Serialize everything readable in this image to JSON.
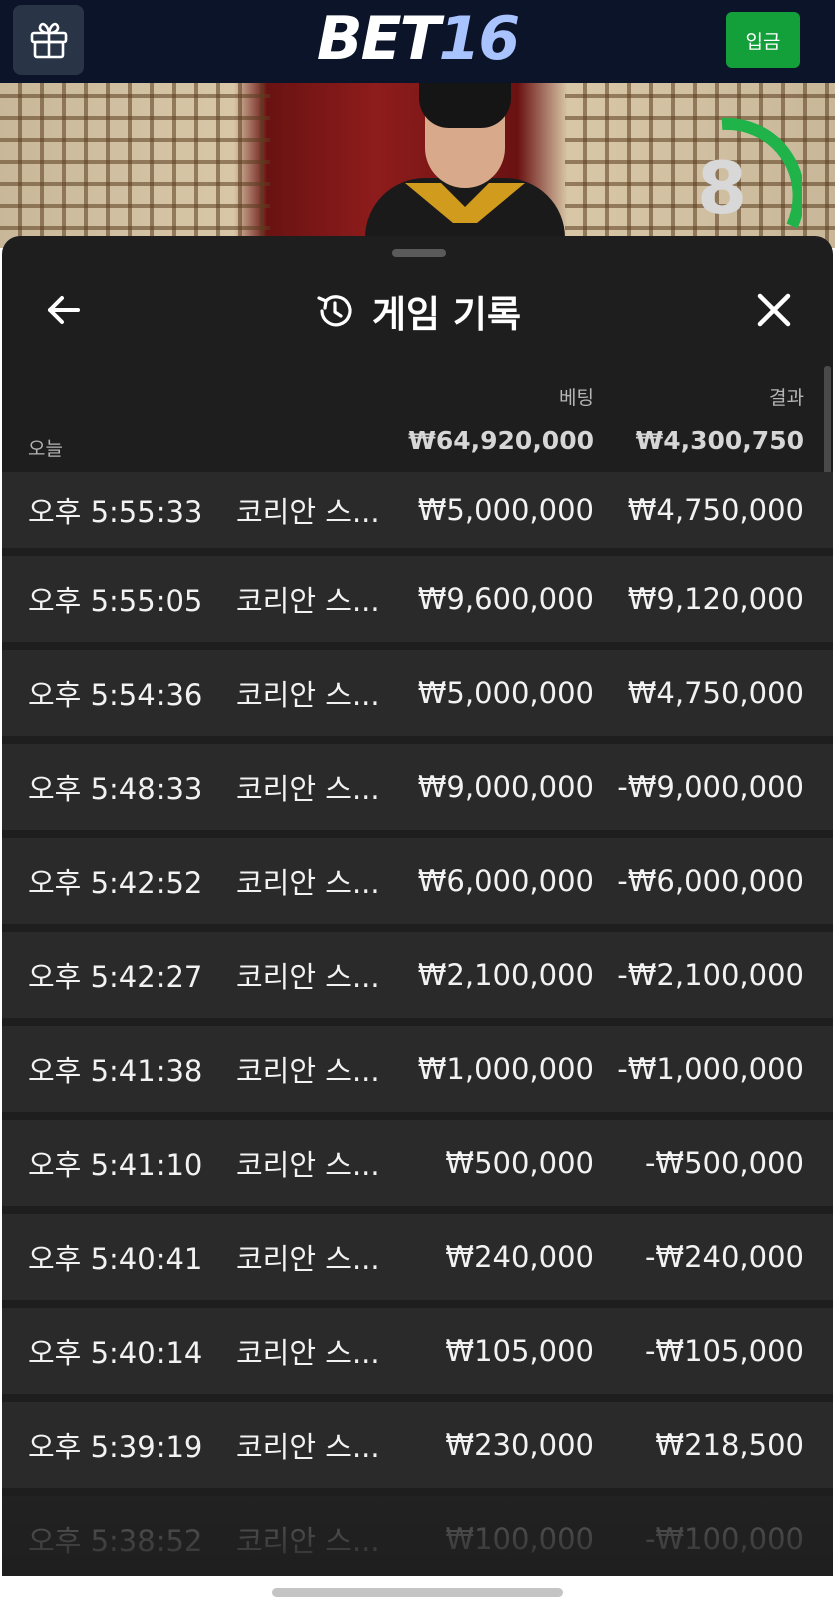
{
  "header": {
    "logo_bet": "BET",
    "logo_num": "16",
    "deposit_label": "입금",
    "icons": {
      "gift": "gift-icon"
    }
  },
  "video": {
    "timer_value": "8",
    "timer_color": "#1fb34a"
  },
  "sheet": {
    "title": "게임 기록",
    "icons": {
      "back": "arrow-left-icon",
      "history": "history-icon",
      "close": "close-icon"
    },
    "col_bet": "베팅",
    "col_result": "결과",
    "today_label": "오늘",
    "total_bet": "₩64,920,000",
    "total_result": "₩4,300,750",
    "rows": [
      {
        "time": "오후 5:55:33",
        "game": "코리안 스...",
        "bet": "₩5,000,000",
        "result": "₩4,750,000"
      },
      {
        "time": "오후 5:55:05",
        "game": "코리안 스...",
        "bet": "₩9,600,000",
        "result": "₩9,120,000"
      },
      {
        "time": "오후 5:54:36",
        "game": "코리안 스...",
        "bet": "₩5,000,000",
        "result": "₩4,750,000"
      },
      {
        "time": "오후 5:48:33",
        "game": "코리안 스...",
        "bet": "₩9,000,000",
        "result": "-₩9,000,000"
      },
      {
        "time": "오후 5:42:52",
        "game": "코리안 스...",
        "bet": "₩6,000,000",
        "result": "-₩6,000,000"
      },
      {
        "time": "오후 5:42:27",
        "game": "코리안 스...",
        "bet": "₩2,100,000",
        "result": "-₩2,100,000"
      },
      {
        "time": "오후 5:41:38",
        "game": "코리안 스...",
        "bet": "₩1,000,000",
        "result": "-₩1,000,000"
      },
      {
        "time": "오후 5:41:10",
        "game": "코리안 스...",
        "bet": "₩500,000",
        "result": "-₩500,000"
      },
      {
        "time": "오후 5:40:41",
        "game": "코리안 스...",
        "bet": "₩240,000",
        "result": "-₩240,000"
      },
      {
        "time": "오후 5:40:14",
        "game": "코리안 스...",
        "bet": "₩105,000",
        "result": "-₩105,000"
      },
      {
        "time": "오후 5:39:19",
        "game": "코리안 스...",
        "bet": "₩230,000",
        "result": "₩218,500"
      },
      {
        "time": "오후 5:38:52",
        "game": "코리안 스...",
        "bet": "₩100,000",
        "result": "-₩100,000"
      }
    ]
  },
  "colors": {
    "deposit_green": "#13a03a",
    "topbar_bg": "#0b1428",
    "sheet_bg": "#1e1e1e",
    "row_bg": "#2a2a2a",
    "logo_accent": "#a9c3ff"
  }
}
